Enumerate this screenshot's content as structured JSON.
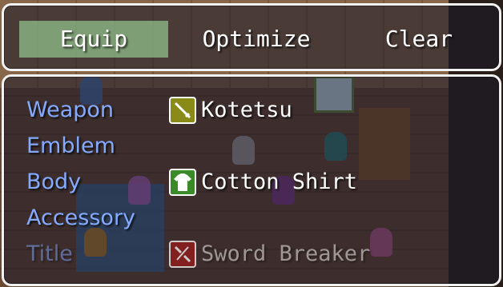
{
  "commands": [
    {
      "label": "Equip",
      "selected": true
    },
    {
      "label": "Optimize",
      "selected": false
    },
    {
      "label": "Clear",
      "selected": false
    }
  ],
  "slots": [
    {
      "label": "Weapon",
      "item": "Kotetsu",
      "icon": "sword-icon",
      "icon_color": "#8a8a18",
      "enabled": true
    },
    {
      "label": "Emblem",
      "item": "",
      "icon": "",
      "enabled": true
    },
    {
      "label": "Body",
      "item": "Cotton Shirt",
      "icon": "shirt-icon",
      "icon_color": "#3a8a2a",
      "enabled": true
    },
    {
      "label": "Accessory",
      "item": "",
      "icon": "",
      "enabled": true
    },
    {
      "label": "Title",
      "item": "Sword Breaker",
      "icon": "broken-sword-icon",
      "icon_color": "#9a1c1c",
      "enabled": false
    }
  ],
  "colors": {
    "slot_label": "#84aaff",
    "selection": "#aaf0aa",
    "window_border": "#f2f2f2"
  }
}
